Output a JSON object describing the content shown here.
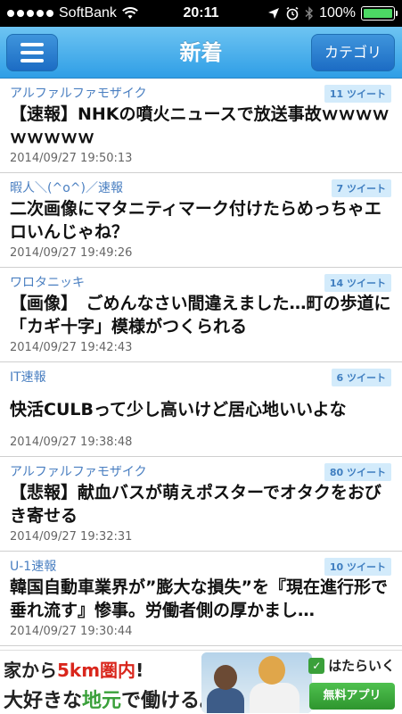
{
  "status_bar": {
    "carrier": "SoftBank",
    "time": "20:11",
    "battery": "100%",
    "battery_level": 1.0
  },
  "nav": {
    "title": "新着",
    "category_label": "カテゴリ"
  },
  "articles": [
    {
      "source": "アルファルファモザイク",
      "tweets": "11 ツイート",
      "title": "【速報】NHKの噴火ニュースで放送事故ｗｗｗｗｗｗｗｗｗ",
      "timestamp": "2014/09/27 19:50:13"
    },
    {
      "source": "暇人＼(^o^)／速報",
      "tweets": "7 ツイート",
      "title": "二次画像にマタニティマーク付けたらめっちゃエロいんじゃね？",
      "timestamp": "2014/09/27 19:49:26"
    },
    {
      "source": "ワロタニッキ",
      "tweets": "14 ツイート",
      "title": "【画像】　ごめんなさい間違えました…町の歩道に「カギ十字」模様がつくられる",
      "timestamp": "2014/09/27 19:42:43"
    },
    {
      "source": "IT速報",
      "tweets": "6 ツイート",
      "title": "快活CULBって少し高いけど居心地いいよな",
      "timestamp": "2014/09/27 19:38:48"
    },
    {
      "source": "アルファルファモザイク",
      "tweets": "80 ツイート",
      "title": "【悲報】献血バスが萌えポスターでオタクをおびき寄せる",
      "timestamp": "2014/09/27 19:32:31"
    },
    {
      "source": "U-1速報",
      "tweets": "10 ツイート",
      "title": "韓国自動車業界が”膨大な損失”を『現在進行形で垂れ流す』惨事。労働者側の厚かまし…",
      "timestamp": "2014/09/27 19:30:44"
    }
  ],
  "ad": {
    "line1_prefix": "家から",
    "line1_highlight": "5km圏内",
    "line1_suffix": "!",
    "line2_prefix": "大好きな",
    "line2_highlight": "地元",
    "line2_suffix": "で働ける。",
    "brand": "はたらいく",
    "button": "無料アプリ"
  },
  "colors": {
    "nav_gradient_top": "#6ec4f2",
    "nav_gradient_bottom": "#2f9ee6",
    "source_text": "#4a7fc1",
    "badge_bg": "#d3ebfb",
    "battery_fill": "#4cd964"
  }
}
